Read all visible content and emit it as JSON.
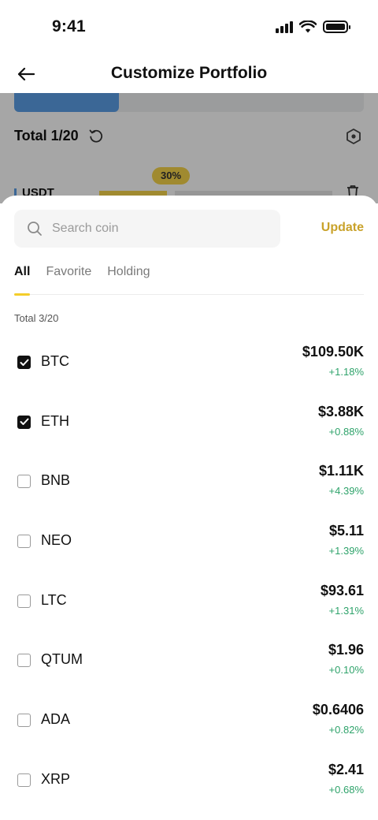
{
  "status_bar": {
    "time": "9:41"
  },
  "header": {
    "title": "Customize Portfolio"
  },
  "background": {
    "total_label": "Total 1/20",
    "badge": "30%",
    "coin": "USDT",
    "progress": 0.3
  },
  "search": {
    "placeholder": "Search coin",
    "value": ""
  },
  "update_label": "Update",
  "tabs": [
    {
      "label": "All"
    },
    {
      "label": "Favorite"
    },
    {
      "label": "Holding"
    }
  ],
  "list_total": "Total 3/20",
  "coins": [
    {
      "symbol": "BTC",
      "price": "$109.50K",
      "change": "+1.18%",
      "checked": true
    },
    {
      "symbol": "ETH",
      "price": "$3.88K",
      "change": "+0.88%",
      "checked": true
    },
    {
      "symbol": "BNB",
      "price": "$1.11K",
      "change": "+4.39%",
      "checked": false
    },
    {
      "symbol": "NEO",
      "price": "$5.11",
      "change": "+1.39%",
      "checked": false
    },
    {
      "symbol": "LTC",
      "price": "$93.61",
      "change": "+1.31%",
      "checked": false
    },
    {
      "symbol": "QTUM",
      "price": "$1.96",
      "change": "+0.10%",
      "checked": false
    },
    {
      "symbol": "ADA",
      "price": "$0.6406",
      "change": "+0.82%",
      "checked": false
    },
    {
      "symbol": "XRP",
      "price": "$2.41",
      "change": "+0.68%",
      "checked": false
    }
  ],
  "colors": {
    "accent": "#f4cd2a",
    "update": "#c9a22a",
    "positive": "#2fa36b",
    "progress": "#5b9fe6"
  }
}
